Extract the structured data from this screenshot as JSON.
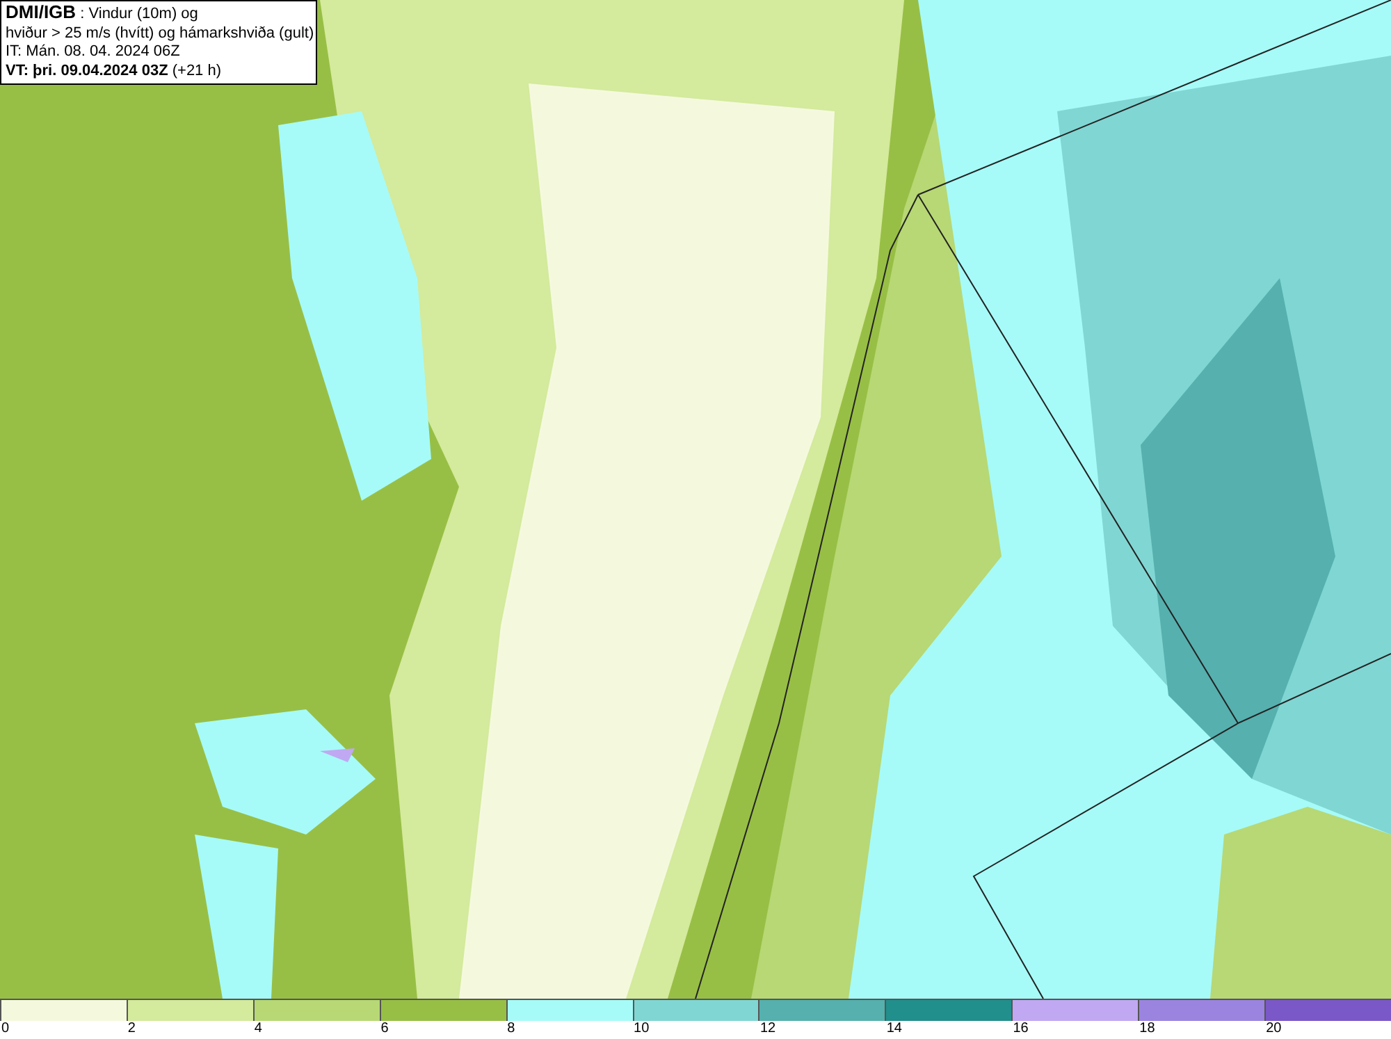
{
  "header": {
    "lines": [
      "**DMI/IGB** : Vindur (10m) og",
      "hviður > 25 m/s (hvítt) og hámarkshviða (gult)",
      "IT: Mán. 08. 04. 2024 06Z",
      "**VT: þri. 09.04.2024 03Z** (+21 h)"
    ]
  },
  "legend": [
    {
      "label": "0",
      "color": "#f4f9de"
    },
    {
      "label": "2",
      "color": "#d4ea9c"
    },
    {
      "label": "4",
      "color": "#b7d874"
    },
    {
      "label": "6",
      "color": "#98bf45"
    },
    {
      "label": "8",
      "color": "#a6fbf8"
    },
    {
      "label": "10",
      "color": "#80d6d3"
    },
    {
      "label": "12",
      "color": "#55b0ae"
    },
    {
      "label": "14",
      "color": "#218f8c"
    },
    {
      "label": "16",
      "color": "#c0a8f2"
    },
    {
      "label": "18",
      "color": "#9a84e0"
    },
    {
      "label": "20",
      "color": "#7b58c8"
    }
  ]
}
